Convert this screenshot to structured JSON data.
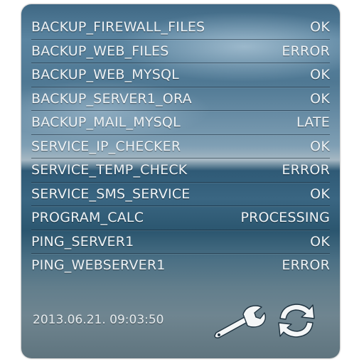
{
  "jobs": [
    {
      "name": "BACKUP_FIREWALL_FILES",
      "status": "OK"
    },
    {
      "name": "BACKUP_WEB_FILES",
      "status": "ERROR"
    },
    {
      "name": "BACKUP_WEB_MYSQL",
      "status": "OK"
    },
    {
      "name": "BACKUP_SERVER1_ORA",
      "status": "OK"
    },
    {
      "name": "BACKUP_MAIL_MYSQL",
      "status": "LATE"
    },
    {
      "name": "SERVICE_IP_CHECKER",
      "status": "OK"
    },
    {
      "name": "SERVICE_TEMP_CHECK",
      "status": "ERROR"
    },
    {
      "name": "SERVICE_SMS_SERVICE",
      "status": "OK"
    },
    {
      "name": "PROGRAM_CALC",
      "status": "PROCESSING"
    },
    {
      "name": "PING_SERVER1",
      "status": "OK"
    },
    {
      "name": "PING_WEBSERVER1",
      "status": "ERROR"
    }
  ],
  "footer": {
    "timestamp": "2013.06.21. 09:03:50",
    "settings_icon": "wrench-icon",
    "refresh_icon": "refresh-icon"
  },
  "colors": {
    "text": "#eef3f6",
    "icon": "#f4f6f7"
  }
}
